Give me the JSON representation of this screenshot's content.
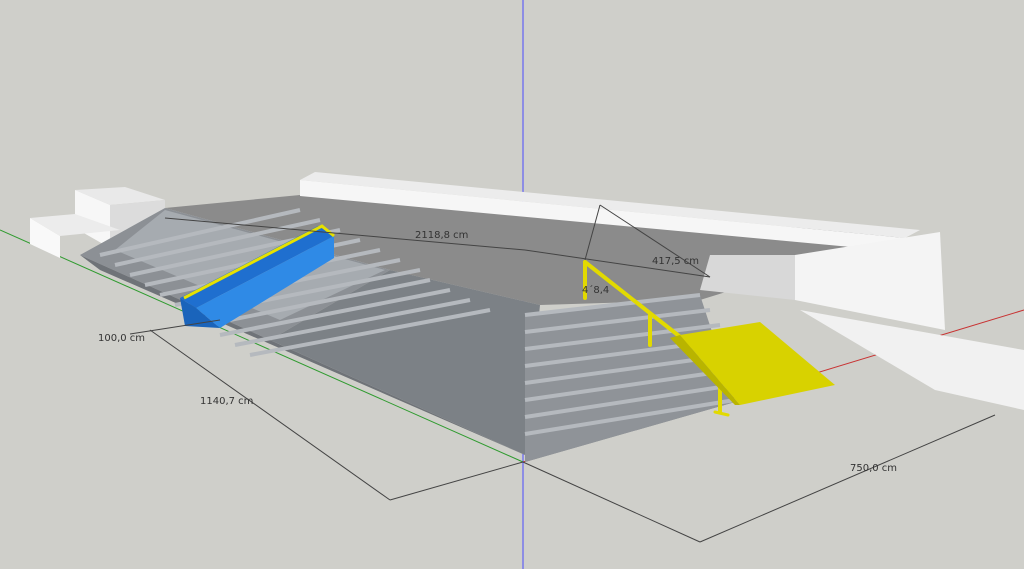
{
  "app": {
    "type": "3D modeling viewport"
  },
  "colors": {
    "background": "#cfcfca",
    "step_dark": "#7d8186",
    "step_light": "#a9adb2",
    "blue_box": "#2f8ae6",
    "yellow_rail": "#e6e100",
    "ramp_yellow": "#d8d200",
    "white_wall": "#f2f2f2",
    "platform_top": "#8a8a8a",
    "axis_blue": "#3b3bff",
    "axis_red": "#cc2a2a",
    "axis_green": "#2a9a2a"
  },
  "dimensions": {
    "platform_length": "2118,8 cm",
    "rail_length": "417,5 cm",
    "rail_height_partial": "4´8,4",
    "front_depth": "100,0 cm",
    "left_side": "1140,7 cm",
    "right_side": "750,0 cm"
  },
  "objects": {
    "blue_box": "blue box obstacle",
    "handrail": "yellow handrail",
    "ramp": "yellow ramp",
    "stairs": "stairs",
    "platform": "platform"
  }
}
